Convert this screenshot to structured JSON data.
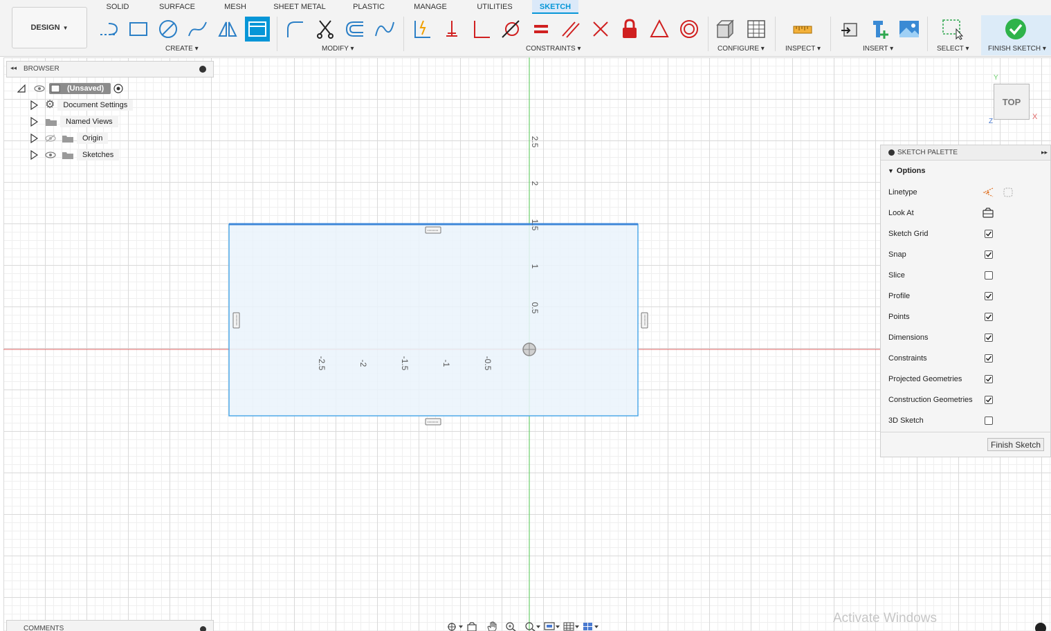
{
  "workspace": {
    "label": "DESIGN"
  },
  "tabs": [
    {
      "label": "SOLID"
    },
    {
      "label": "SURFACE"
    },
    {
      "label": "MESH"
    },
    {
      "label": "SHEET METAL"
    },
    {
      "label": "PLASTIC"
    },
    {
      "label": "MANAGE"
    },
    {
      "label": "UTILITIES"
    },
    {
      "label": "SKETCH",
      "active": true
    }
  ],
  "groups": {
    "create": "CREATE",
    "modify": "MODIFY",
    "constraints": "CONSTRAINTS",
    "configure": "CONFIGURE",
    "inspect": "INSPECT",
    "insert": "INSERT",
    "select": "SELECT",
    "finish": "FINISH SKETCH"
  },
  "browser": {
    "title": "BROWSER",
    "root": "(Unsaved)",
    "items": [
      "Document Settings",
      "Named Views",
      "Origin",
      "Sketches"
    ]
  },
  "palette": {
    "title": "SKETCH PALETTE",
    "section": "Options",
    "options": [
      {
        "label": "Linetype"
      },
      {
        "label": "Look At"
      },
      {
        "label": "Sketch Grid",
        "checked": true
      },
      {
        "label": "Snap",
        "checked": true
      },
      {
        "label": "Slice",
        "checked": false
      },
      {
        "label": "Profile",
        "checked": true
      },
      {
        "label": "Points",
        "checked": true
      },
      {
        "label": "Dimensions",
        "checked": true
      },
      {
        "label": "Constraints",
        "checked": true
      },
      {
        "label": "Projected Geometries",
        "checked": true
      },
      {
        "label": "Construction Geometries",
        "checked": true
      },
      {
        "label": "3D Sketch",
        "checked": false
      }
    ],
    "finish_button": "Finish Sketch"
  },
  "viewcube": {
    "face": "TOP",
    "x": "X",
    "y": "Y",
    "z": "Z"
  },
  "axis_ticks": {
    "y": [
      "2.5",
      "2",
      "1.5",
      "1",
      "0.5"
    ],
    "x": [
      "-2.5",
      "-2",
      "-1.5",
      "-1",
      "-0.5"
    ]
  },
  "comments": {
    "title": "COMMENTS"
  },
  "watermark": "Activate Windows",
  "colors": {
    "accent": "#0696d7",
    "x_axis": "#e06666",
    "y_axis": "#6ccf6c",
    "sketch_line": "#4fa8e8",
    "profile_fill": "#eaf3fb"
  }
}
